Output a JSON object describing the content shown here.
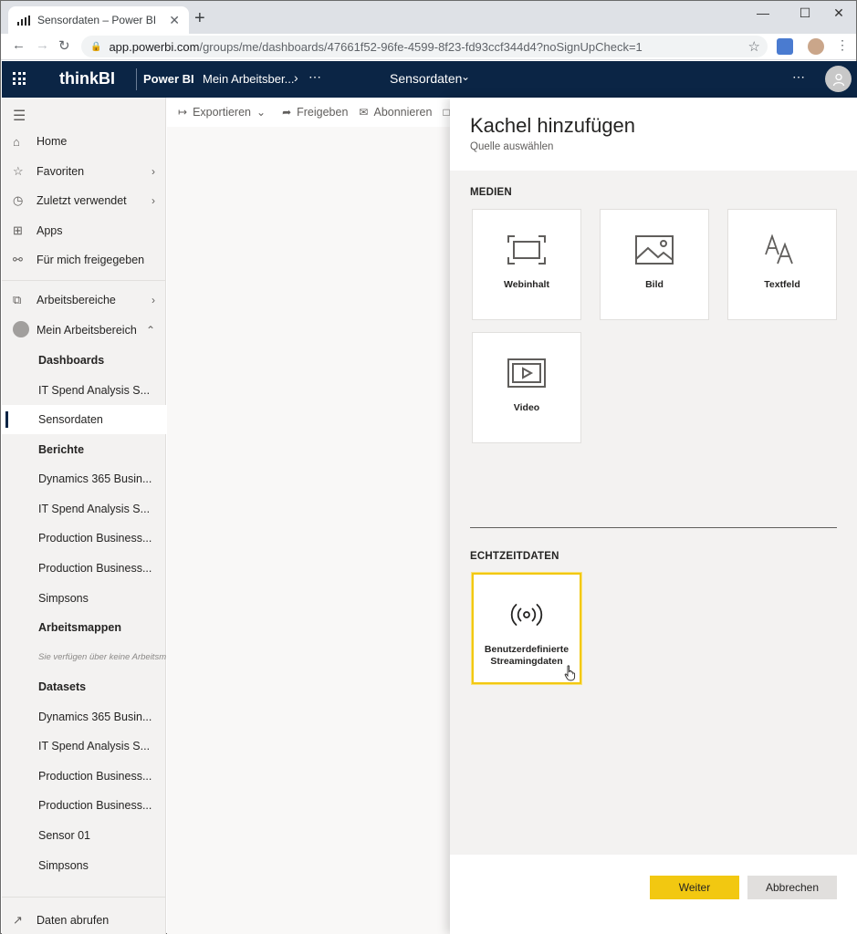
{
  "browser": {
    "tab_title": "Sensordaten – Power BI",
    "close_glyph": "✕",
    "new_tab_glyph": "+",
    "url_host": "app.powerbi.com",
    "url_path": "/groups/me/dashboards/47661f52-96fe-4599-8f23-fd93ccf344d4?noSignUpCheck=1"
  },
  "header": {
    "brand": "thinkBI",
    "product": "Power BI",
    "workspace_crumb": "Mein Arbeitsber...",
    "dashboard_title": "Sensordaten",
    "background_color": "#0b2545"
  },
  "sidebar": {
    "nav_items": [
      {
        "label": "Home",
        "icon": "home-icon"
      },
      {
        "label": "Favoriten",
        "icon": "star-icon"
      },
      {
        "label": "Zuletzt verwendet",
        "icon": "clock-icon"
      },
      {
        "label": "Apps",
        "icon": "apps-icon"
      },
      {
        "label": "Für mich freigegeben",
        "icon": "shared-icon"
      }
    ],
    "workspaces_label": "Arbeitsbereiche",
    "my_workspace_label": "Mein Arbeitsbereich",
    "dashboards_heading": "Dashboards",
    "dashboards": [
      "IT Spend Analysis S...",
      "Sensordaten"
    ],
    "reports_heading": "Berichte",
    "reports": [
      "Dynamics 365 Busin...",
      "IT Spend Analysis S...",
      "Production Business...",
      "Production Business...",
      "Simpsons"
    ],
    "workbooks_heading": "Arbeitsmappen",
    "workbooks_empty": "Sie verfügen über keine Arbeitsmappen",
    "datasets_heading": "Datasets",
    "datasets": [
      "Dynamics 365 Busin...",
      "IT Spend Analysis S...",
      "Production Business...",
      "Production Business...",
      "Sensor 01",
      "Simpsons"
    ],
    "get_data_label": "Daten abrufen"
  },
  "toolbar": {
    "export_label": "Exportieren",
    "share_label": "Freigeben",
    "subscribe_label": "Abonnieren"
  },
  "pane": {
    "title": "Kachel hinzufügen",
    "subtitle": "Quelle auswählen",
    "media_heading": "MEDIEN",
    "media_tiles": [
      "Webinhalt",
      "Bild",
      "Textfeld",
      "Video"
    ],
    "realtime_heading": "ECHTZEITDATEN",
    "realtime_tile": "Benutzerdefinierte Streamingdaten",
    "next_button": "Weiter",
    "cancel_button": "Abbrechen",
    "accent_color": "#f2c811"
  }
}
